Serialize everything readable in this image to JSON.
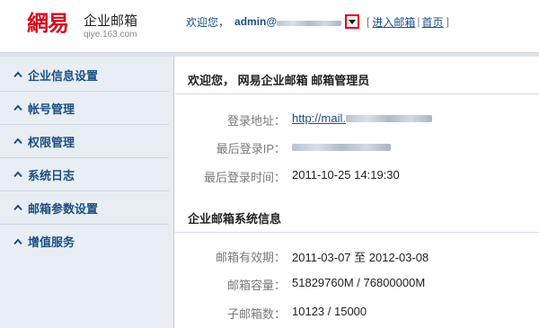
{
  "header": {
    "logo_mark": "網易",
    "logo_name": "企业邮箱",
    "logo_domain": "qiye.163.com",
    "welcome": "欢迎您，",
    "admin_prefix": "admin@",
    "enter_mailbox": "进入邮箱",
    "home": "首页",
    "bracket_open": "[",
    "bracket_close": "]",
    "separator": "|"
  },
  "sidebar": {
    "items": [
      {
        "label": "企业信息设置"
      },
      {
        "label": "帐号管理"
      },
      {
        "label": "权限管理"
      },
      {
        "label": "系统日志"
      },
      {
        "label": "邮箱参数设置"
      },
      {
        "label": "增值服务"
      }
    ]
  },
  "main": {
    "welcome_title": "欢迎您， 网易企业邮箱 邮箱管理员",
    "login_info": [
      {
        "label": "登录地址：",
        "value": "http://mail."
      },
      {
        "label": "最后登录IP：",
        "value": ""
      },
      {
        "label": "最后登录时间：",
        "value": "2011-10-25 14:19:30"
      }
    ],
    "system_title": "企业邮箱系统信息",
    "system_info": [
      {
        "label": "邮箱有效期：",
        "value": "2011-03-07 至 2012-03-08"
      },
      {
        "label": "邮箱容量：",
        "value": "51829760M / 76800000M"
      },
      {
        "label": "子邮箱数：",
        "value": "10123 / 15000"
      }
    ]
  },
  "colors": {
    "brand_red": "#d40e1e",
    "link_blue": "#1b4f83",
    "sidebar_bg": "#e9eef4",
    "highlight_red": "#e60012"
  }
}
